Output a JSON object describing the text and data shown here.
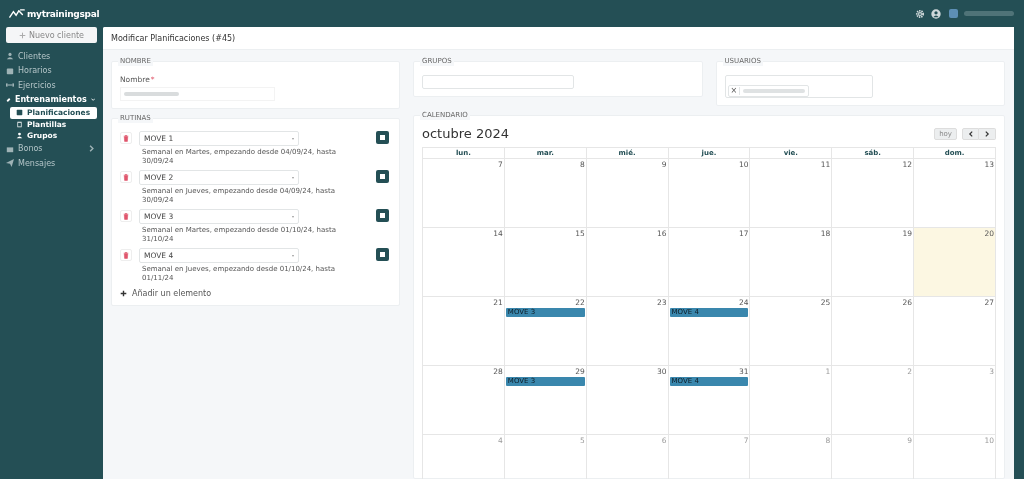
{
  "app": {
    "logo": "mytrainingspal"
  },
  "sidebar": {
    "new_button": "Nuevo cliente",
    "items": [
      {
        "label": "Clientes",
        "selected": false
      },
      {
        "label": "Horarios",
        "selected": false
      },
      {
        "label": "Ejercicios",
        "selected": false
      },
      {
        "label": "Entrenamientos",
        "selected": true,
        "expanded": true,
        "children": [
          {
            "label": "Planificaciones",
            "selected": true
          },
          {
            "label": "Plantillas",
            "selected": false
          },
          {
            "label": "Grupos",
            "selected": false
          }
        ]
      },
      {
        "label": "Bonos",
        "selected": false,
        "expanded": false
      },
      {
        "label": "Mensajes",
        "selected": false
      }
    ]
  },
  "page": {
    "title": "Modificar Planificaciones (#45)"
  },
  "nombre": {
    "section": "NOMBRE",
    "label": "Nombre",
    "required_mark": "*"
  },
  "grupos": {
    "section": "GRUPOS"
  },
  "usuarios": {
    "section": "USUARIOS",
    "chip_remove": "×"
  },
  "rutinas": {
    "section": "RUTINAS",
    "add_label": "Añadir un elemento",
    "items": [
      {
        "value": "MOVE 1",
        "description": "Semanal en Martes, empezando desde 04/09/24, hasta 30/09/24"
      },
      {
        "value": "MOVE 2",
        "description": "Semanal en Jueves, empezando desde 04/09/24, hasta 30/09/24"
      },
      {
        "value": "MOVE 3",
        "description": "Semanal en Martes, empezando desde 01/10/24, hasta 31/10/24"
      },
      {
        "value": "MOVE 4",
        "description": "Semanal en Jueves, empezando desde 01/10/24, hasta 01/11/24"
      }
    ]
  },
  "calendario": {
    "section": "CALENDARIO",
    "title": "octubre 2024",
    "today_button": "hoy",
    "weekdays": [
      "lun.",
      "mar.",
      "mié.",
      "jue.",
      "vie.",
      "sáb.",
      "dom."
    ],
    "weeks": [
      [
        {
          "day": "7",
          "other_month": false,
          "today": false
        },
        {
          "day": "8",
          "other_month": false,
          "today": false
        },
        {
          "day": "9",
          "other_month": false,
          "today": false
        },
        {
          "day": "10",
          "other_month": false,
          "today": false
        },
        {
          "day": "11",
          "other_month": false,
          "today": false
        },
        {
          "day": "12",
          "other_month": false,
          "today": false
        },
        {
          "day": "13",
          "other_month": false,
          "today": false
        }
      ],
      [
        {
          "day": "14",
          "other_month": false,
          "today": false
        },
        {
          "day": "15",
          "other_month": false,
          "today": false
        },
        {
          "day": "16",
          "other_month": false,
          "today": false
        },
        {
          "day": "17",
          "other_month": false,
          "today": false
        },
        {
          "day": "18",
          "other_month": false,
          "today": false
        },
        {
          "day": "19",
          "other_month": false,
          "today": false
        },
        {
          "day": "20",
          "other_month": false,
          "today": true
        }
      ],
      [
        {
          "day": "21",
          "other_month": false,
          "today": false
        },
        {
          "day": "22",
          "other_month": false,
          "today": false,
          "events": [
            "MOVE 3"
          ]
        },
        {
          "day": "23",
          "other_month": false,
          "today": false
        },
        {
          "day": "24",
          "other_month": false,
          "today": false,
          "events": [
            "MOVE 4"
          ]
        },
        {
          "day": "25",
          "other_month": false,
          "today": false
        },
        {
          "day": "26",
          "other_month": false,
          "today": false
        },
        {
          "day": "27",
          "other_month": false,
          "today": false
        }
      ],
      [
        {
          "day": "28",
          "other_month": false,
          "today": false
        },
        {
          "day": "29",
          "other_month": false,
          "today": false,
          "events": [
            "MOVE 3"
          ]
        },
        {
          "day": "30",
          "other_month": false,
          "today": false
        },
        {
          "day": "31",
          "other_month": false,
          "today": false,
          "events": [
            "MOVE 4"
          ]
        },
        {
          "day": "1",
          "other_month": true,
          "today": false
        },
        {
          "day": "2",
          "other_month": true,
          "today": false
        },
        {
          "day": "3",
          "other_month": true,
          "today": false
        }
      ],
      [
        {
          "day": "4",
          "other_month": true,
          "today": false
        },
        {
          "day": "5",
          "other_month": true,
          "today": false
        },
        {
          "day": "6",
          "other_month": true,
          "today": false
        },
        {
          "day": "7",
          "other_month": true,
          "today": false
        },
        {
          "day": "8",
          "other_month": true,
          "today": false
        },
        {
          "day": "9",
          "other_month": true,
          "today": false
        },
        {
          "day": "10",
          "other_month": true,
          "today": false
        }
      ]
    ]
  }
}
